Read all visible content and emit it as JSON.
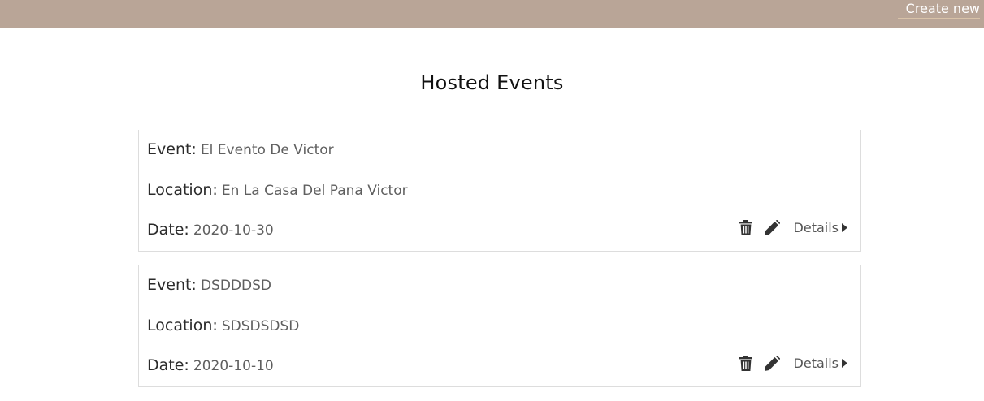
{
  "nav": {
    "create_label": "Create new"
  },
  "page": {
    "title": "Hosted Events"
  },
  "labels": {
    "event": "Event:",
    "location": "Location:",
    "date": "Date:",
    "details": "Details"
  },
  "events": [
    {
      "name": "El Evento De Victor",
      "location": "En La Casa Del Pana Victor",
      "date": "2020-10-30"
    },
    {
      "name": "DSDDDSD",
      "location": "SDSDSDSD",
      "date": "2020-10-10"
    }
  ],
  "icons": {
    "delete": "trash-icon",
    "edit": "pencil-icon",
    "details": "caret-right-icon"
  },
  "colors": {
    "topbar": "#b9a597",
    "accent_underline": "#d8c2a8",
    "icon": "#333333"
  }
}
